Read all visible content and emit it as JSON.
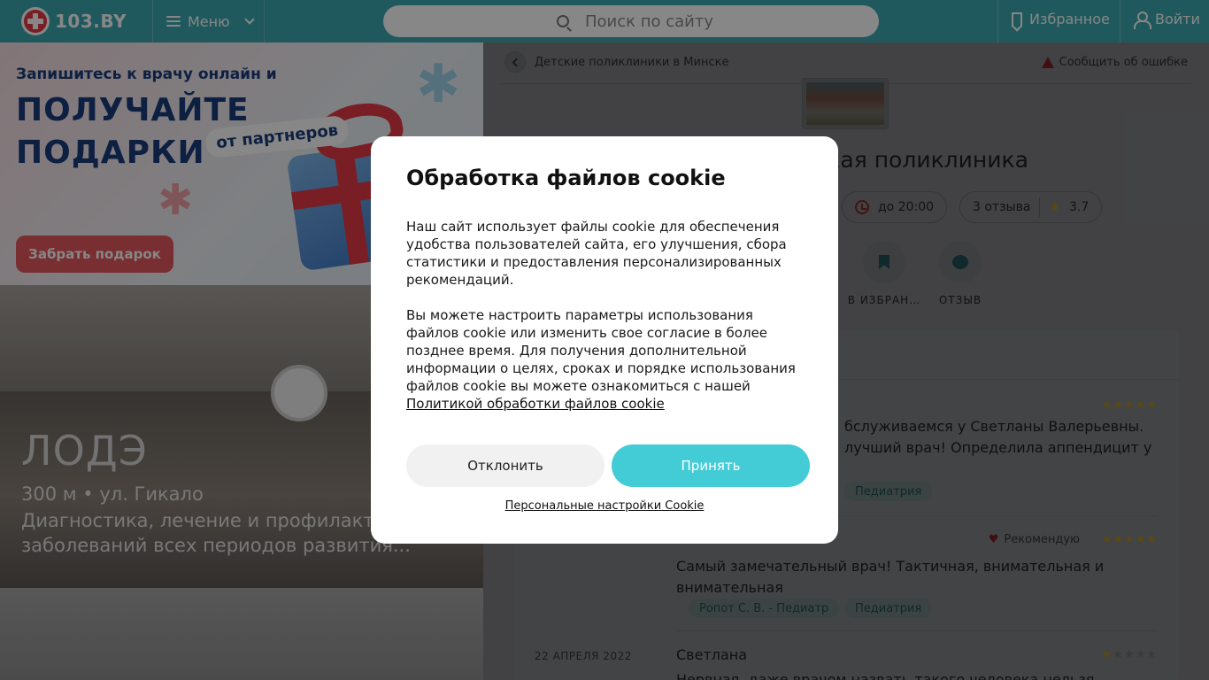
{
  "header": {
    "logo_text": "103.BY",
    "menu_label": "Меню",
    "search_placeholder": "Поиск по сайту",
    "favorites_label": "Избранное",
    "login_label": "Войти"
  },
  "promo": {
    "line1": "Запишитесь к врачу онлайн и",
    "line2": "ПОЛУЧАЙТЕ",
    "line3": "ПОДАРКИ",
    "tag": "от партнеров",
    "button": "Забрать подарок"
  },
  "ad_clinic": {
    "name": "ЛОДЭ",
    "address": "300 м • ул. Гикало",
    "description": "Диагностика, лечение и профилактика заболеваний всех периодов развития..."
  },
  "breadcrumb": {
    "label": "Детские поликлиники в Минске"
  },
  "report_label": "Сообщить об ошибке",
  "page": {
    "title_visible": "тская поликлиника",
    "hours": "до 20:00",
    "reviews_count": "3 отзыва",
    "rating": "3.7"
  },
  "actions": [
    {
      "label": "В ИЗБРАН…",
      "icon": "bookmark-icon"
    },
    {
      "label": "ОТЗЫВ",
      "icon": "comment-icon"
    }
  ],
  "reviews": [
    {
      "date": "",
      "name": "",
      "text": "бслуживаемся у Светланы Валерьевны. лучший врач! Определила аппендицит у",
      "stars": 5,
      "tags": [
        "Педиатрия"
      ],
      "recommend": ""
    },
    {
      "date": "",
      "name": "",
      "text": "Самый замечательный врач! Тактичная, внимательная и внимательная",
      "stars": 5,
      "tags": [
        "Ропот С. В. - Педиатр",
        "Педиатрия"
      ],
      "recommend": "Рекомендую"
    },
    {
      "date": "22 АПРЕЛЯ 2022",
      "name": "Светлана",
      "text": "Нервная, даже врачом назвать такого человека нельзя. После",
      "stars": 1,
      "tags": [],
      "recommend": ""
    }
  ],
  "cookie_modal": {
    "title": "Обработка файлов cookie",
    "paragraph1": "Наш сайт использует файлы cookie для обеспечения удобства пользователей сайта, его улучшения, сбора статистики и предоставления персонализированных рекомендаций.",
    "paragraph2": "Вы можете настроить параметры использования файлов cookie или изменить свое согласие в более позднее время. Для получения дополнительной информации о целях, сроках и порядке использования файлов cookie вы можете ознакомиться с нашей",
    "policy_link": "Политикой обработки файлов cookie",
    "decline_label": "Отклонить",
    "accept_label": "Принять",
    "settings_link": "Персональные настройки Cookie"
  },
  "colors": {
    "header_bg": "#3ba8b0",
    "accent": "#43ccd6",
    "star": "#f5c518",
    "promo_button": "#e5585e"
  }
}
